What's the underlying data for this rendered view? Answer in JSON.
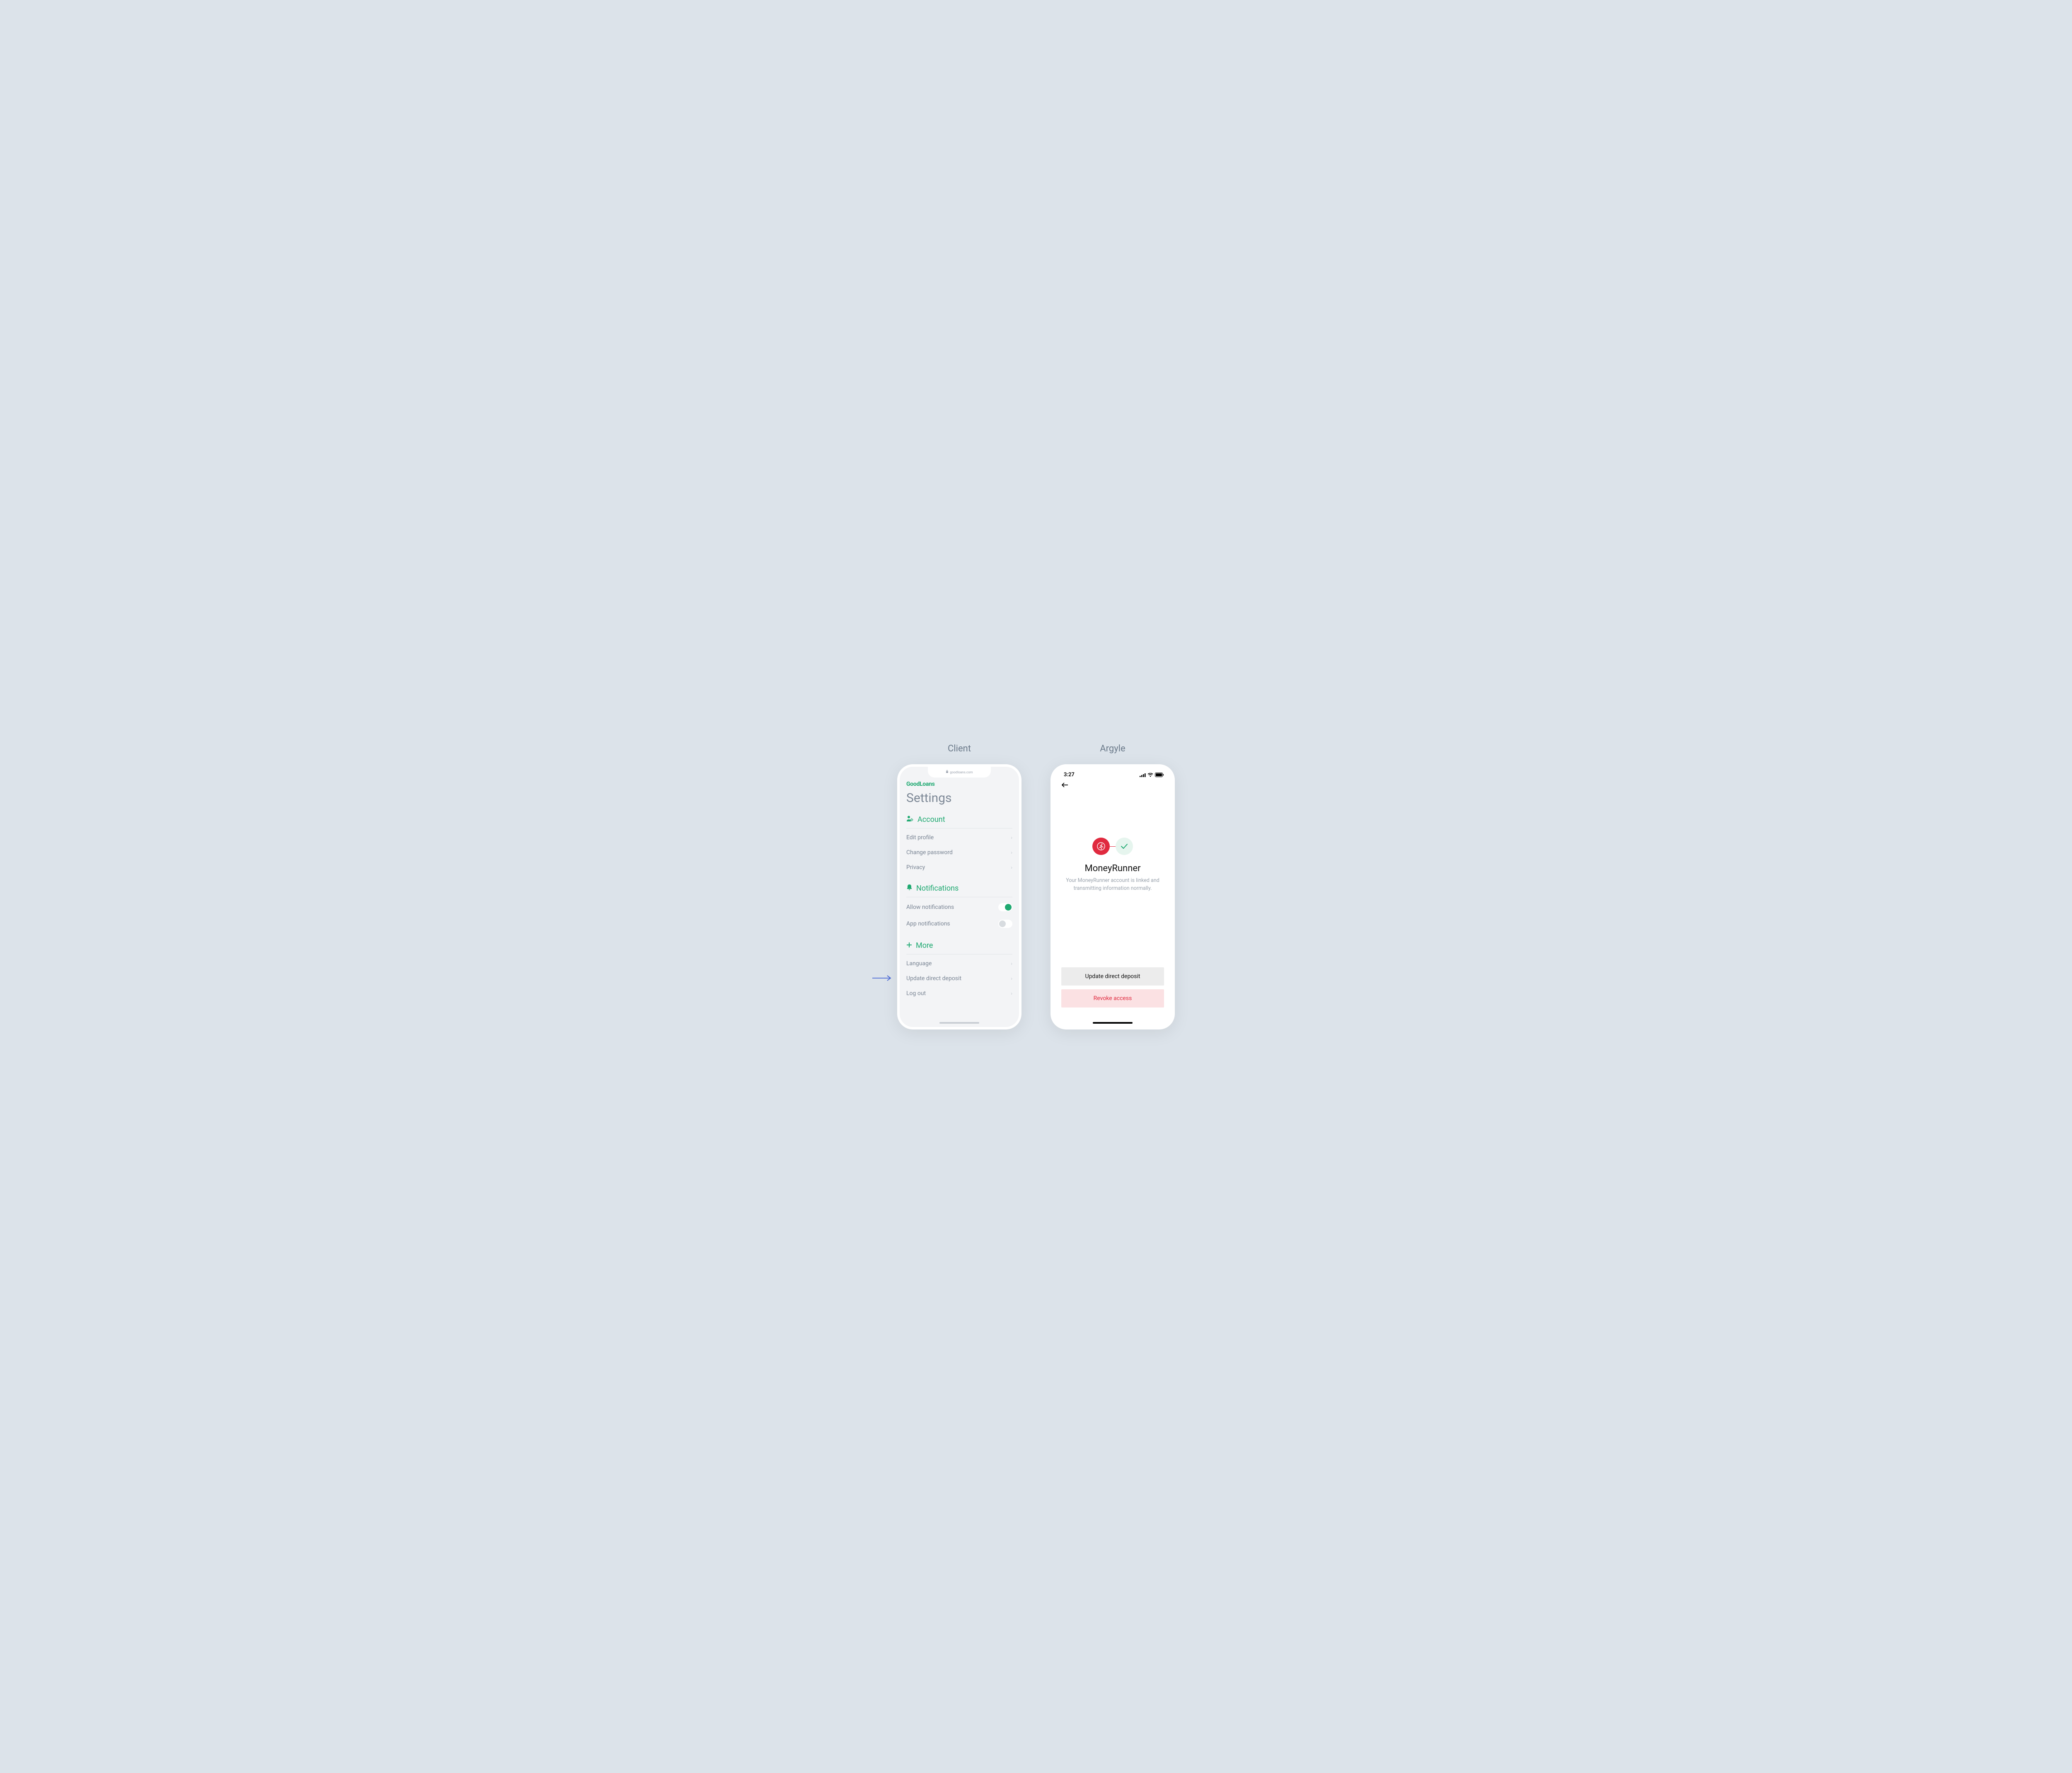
{
  "columns": {
    "left_title": "Client",
    "right_title": "Argyle"
  },
  "client": {
    "url": "goodloans.com",
    "brand": "GoodLoans",
    "page_title": "Settings",
    "sections": {
      "account": {
        "title": "Account",
        "items": [
          {
            "label": "Edit profile"
          },
          {
            "label": "Change password"
          },
          {
            "label": "Privacy"
          }
        ]
      },
      "notifications": {
        "title": "Notifications",
        "items": [
          {
            "label": "Allow notifications",
            "toggle": true
          },
          {
            "label": "App notifications",
            "toggle": false
          }
        ]
      },
      "more": {
        "title": "More",
        "items": [
          {
            "label": "Language"
          },
          {
            "label": "Update direct deposit"
          },
          {
            "label": "Log out"
          }
        ]
      }
    }
  },
  "argyle": {
    "status_time": "3:27",
    "title": "MoneyRunner",
    "description": "Your MoneyRunner account is linked and transmitting information normally.",
    "buttons": {
      "update": "Update direct deposit",
      "revoke": "Revoke access"
    }
  }
}
